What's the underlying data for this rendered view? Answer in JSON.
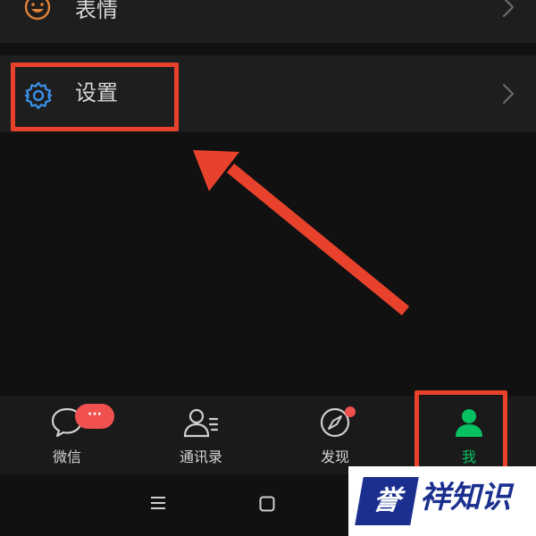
{
  "list": {
    "items": [
      {
        "label": "表情",
        "icon": "emoji-icon",
        "color": "#e0823a"
      },
      {
        "label": "设置",
        "icon": "gear-icon",
        "color": "#3a8ee6"
      }
    ]
  },
  "tabbar": {
    "tabs": [
      {
        "label": "微信",
        "icon": "chat-bubble-icon",
        "badge": "···"
      },
      {
        "label": "通讯录",
        "icon": "contacts-icon"
      },
      {
        "label": "发现",
        "icon": "compass-icon",
        "badge_dot": true
      },
      {
        "label": "我",
        "icon": "person-icon",
        "active": true
      }
    ],
    "active_color": "#07c160",
    "badge_color": "#f05050"
  },
  "system_nav": {
    "buttons": [
      "menu-icon",
      "home-icon",
      "back-icon"
    ]
  },
  "annotation": {
    "color": "#e8422c"
  },
  "watermark": {
    "mark": "誉",
    "text": "祥知识"
  }
}
